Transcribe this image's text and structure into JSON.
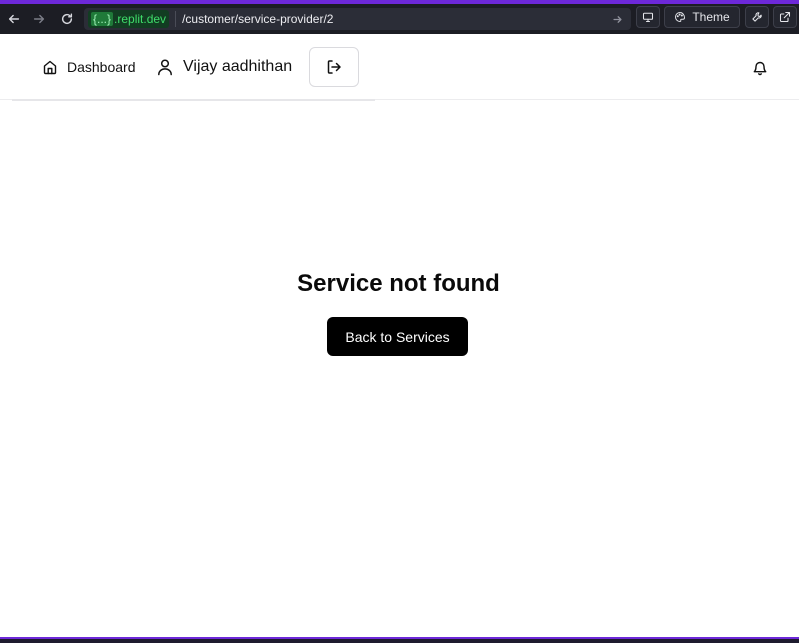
{
  "browser": {
    "domain_braces": "{...}",
    "domain": ".replit.dev",
    "path": "/customer/service-provider/2",
    "theme_label": "Theme"
  },
  "header": {
    "dashboard_label": "Dashboard",
    "user_name": "Vijay aadhithan"
  },
  "main": {
    "title": "Service not found",
    "back_button_label": "Back to Services"
  },
  "colors": {
    "accent": "#6d28d9",
    "browser_bar": "#1c1d24",
    "domain_green": "#3fdc6a",
    "primary_button": "#000000"
  }
}
